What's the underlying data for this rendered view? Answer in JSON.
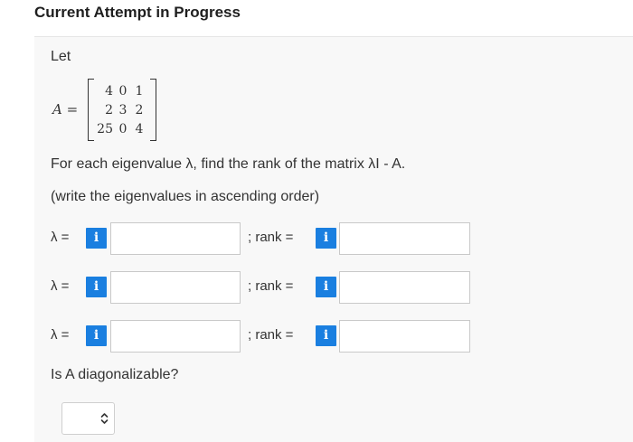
{
  "header": {
    "title": "Current Attempt in Progress"
  },
  "question": {
    "intro": "Let",
    "matrix": {
      "label": "A",
      "equals": "=",
      "rows": [
        [
          "4",
          "0",
          "1"
        ],
        [
          "2",
          "3",
          "2"
        ],
        [
          "25",
          "0",
          "4"
        ]
      ]
    },
    "instruction_1": "For each eigenvalue λ, find the rank of the matrix λI - A.",
    "instruction_2": "(write the eigenvalues in ascending order)",
    "answer_rows": [
      {
        "lambda_label": "λ =",
        "lambda_value": "",
        "rank_label": "; rank =",
        "rank_value": ""
      },
      {
        "lambda_label": "λ =",
        "lambda_value": "",
        "rank_label": "; rank =",
        "rank_value": ""
      },
      {
        "lambda_label": "λ =",
        "lambda_value": "",
        "rank_label": "; rank =",
        "rank_value": ""
      }
    ],
    "info_glyph": "i",
    "diagonalizable_prompt": "Is A diagonalizable?",
    "diagonalizable_selected": ""
  },
  "colors": {
    "info_button": "#1a7fe0",
    "panel_background": "#f8f8f8"
  },
  "icons": {
    "info": "info-icon",
    "select_arrows": "up-down-chevron-icon"
  }
}
